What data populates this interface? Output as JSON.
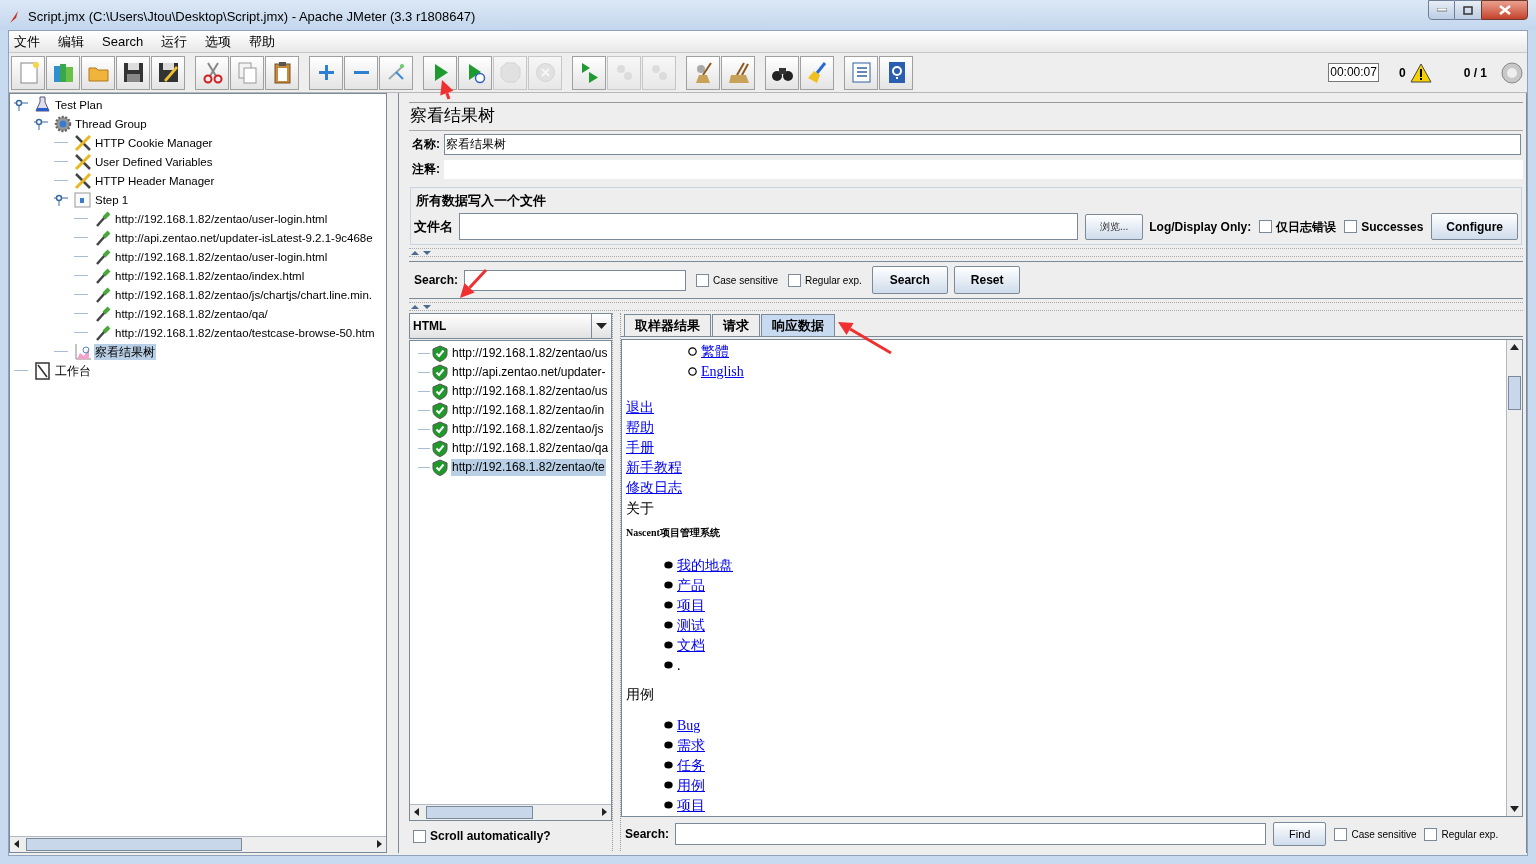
{
  "window": {
    "title": "Script.jmx (C:\\Users\\Jtou\\Desktop\\Script.jmx) - Apache JMeter (3.3 r1808647)"
  },
  "menu": [
    "文件",
    "编辑",
    "Search",
    "运行",
    "选项",
    "帮助"
  ],
  "toolbar": [
    [
      {
        "kind": "new",
        "disabled": false
      },
      {
        "kind": "templates",
        "disabled": false
      },
      {
        "kind": "open",
        "disabled": false
      },
      {
        "kind": "save",
        "disabled": false
      },
      {
        "kind": "save_as",
        "disabled": false
      }
    ],
    [
      {
        "kind": "cut",
        "disabled": false
      },
      {
        "kind": "copy",
        "disabled": false
      },
      {
        "kind": "paste",
        "disabled": false
      }
    ],
    [
      {
        "kind": "expand",
        "disabled": false
      },
      {
        "kind": "collapse",
        "disabled": false
      },
      {
        "kind": "toggle",
        "disabled": false
      }
    ],
    [
      {
        "kind": "start",
        "disabled": false
      },
      {
        "kind": "start_no_pause",
        "disabled": false
      },
      {
        "kind": "stop",
        "disabled": true
      },
      {
        "kind": "shutdown",
        "disabled": true
      }
    ],
    [
      {
        "kind": "remote_start",
        "disabled": false
      },
      {
        "kind": "remote_stop",
        "disabled": true
      },
      {
        "kind": "remote_shutdown",
        "disabled": true
      }
    ],
    [
      {
        "kind": "clear",
        "disabled": false
      },
      {
        "kind": "clear_all",
        "disabled": false
      }
    ],
    [
      {
        "kind": "search",
        "disabled": false
      },
      {
        "kind": "reset_search",
        "disabled": false
      }
    ],
    [
      {
        "kind": "function_helper",
        "disabled": false
      },
      {
        "kind": "help",
        "disabled": false
      }
    ]
  ],
  "status": {
    "timer": "00:00:07",
    "warnings": "0",
    "threads": "0 / 1"
  },
  "tree": [
    {
      "label": "Test Plan",
      "kind": "plan",
      "selected": false,
      "expanded": true,
      "children": [
        {
          "label": "Thread Group",
          "kind": "thread_group",
          "selected": false,
          "expanded": true,
          "children": [
            {
              "label": "HTTP Cookie Manager",
              "kind": "config",
              "selected": false
            },
            {
              "label": "User Defined Variables",
              "kind": "config",
              "selected": false
            },
            {
              "label": "HTTP Header Manager",
              "kind": "config",
              "selected": false
            },
            {
              "label": "Step 1",
              "kind": "controller",
              "selected": false,
              "expanded": true,
              "children": [
                {
                  "label": "http://192.168.1.82/zentao/user-login.html",
                  "kind": "sampler",
                  "selected": false
                },
                {
                  "label": "http://api.zentao.net/updater-isLatest-9.2.1-9c468e",
                  "kind": "sampler",
                  "selected": false
                },
                {
                  "label": "http://192.168.1.82/zentao/user-login.html",
                  "kind": "sampler",
                  "selected": false
                },
                {
                  "label": "http://192.168.1.82/zentao/index.html",
                  "kind": "sampler",
                  "selected": false
                },
                {
                  "label": "http://192.168.1.82/zentao/js/chartjs/chart.line.min.",
                  "kind": "sampler",
                  "selected": false
                },
                {
                  "label": "http://192.168.1.82/zentao/qa/",
                  "kind": "sampler",
                  "selected": false
                },
                {
                  "label": "http://192.168.1.82/zentao/testcase-browse-50.htm",
                  "kind": "sampler",
                  "selected": false
                }
              ]
            },
            {
              "label": "察看结果树",
              "kind": "listener",
              "selected": true
            }
          ]
        }
      ]
    },
    {
      "label": "工作台",
      "kind": "workbench",
      "selected": false
    }
  ],
  "panel": {
    "title": "察看结果树",
    "name_label": "名称:",
    "name_value": "察看结果树",
    "comment_label": "注释:",
    "file_group": {
      "legend": "所有数据写入一个文件",
      "file_label": "文件名",
      "browse": "浏览...",
      "log_label": "Log/Display Only:",
      "checks": [
        {
          "label": "仅日志错误",
          "checked": false
        },
        {
          "label": "Successes",
          "checked": false
        }
      ],
      "configure": "Configure"
    },
    "search": {
      "label": "Search:",
      "checks": [
        {
          "label": "Case sensitive",
          "checked": false
        },
        {
          "label": "Regular exp.",
          "checked": false
        }
      ],
      "search_button": "Search",
      "reset_button": "Reset"
    },
    "renderer": "HTML",
    "results": [
      {
        "label": "http://192.168.1.82/zentao/us",
        "success": true,
        "selected": false
      },
      {
        "label": "http://api.zentao.net/updater-",
        "success": true,
        "selected": false
      },
      {
        "label": "http://192.168.1.82/zentao/us",
        "success": true,
        "selected": false
      },
      {
        "label": "http://192.168.1.82/zentao/in",
        "success": true,
        "selected": false
      },
      {
        "label": "http://192.168.1.82/zentao/js",
        "success": true,
        "selected": false
      },
      {
        "label": "http://192.168.1.82/zentao/qa",
        "success": true,
        "selected": false
      },
      {
        "label": "http://192.168.1.82/zentao/te",
        "success": true,
        "selected": true
      }
    ],
    "scroll_auto": {
      "label": "Scroll automatically?",
      "checked": false
    },
    "tabs": [
      {
        "label": "取样器结果",
        "selected": false
      },
      {
        "label": "请求",
        "selected": false
      },
      {
        "label": "响应数据",
        "selected": true
      }
    ],
    "response": [
      {
        "kind": "circle_link",
        "text": "繁體"
      },
      {
        "kind": "circle_link",
        "text": "English"
      },
      {
        "kind": "link",
        "text": "退出"
      },
      {
        "kind": "link",
        "text": "帮助"
      },
      {
        "kind": "link",
        "text": "手册"
      },
      {
        "kind": "link",
        "text": "新手教程"
      },
      {
        "kind": "link",
        "text": "修改日志"
      },
      {
        "kind": "text",
        "text": "关于"
      },
      {
        "kind": "heading",
        "text": "Nascent项目管理系统"
      },
      {
        "kind": "bullet_link",
        "text": "我的地盘"
      },
      {
        "kind": "bullet_link",
        "text": "产品"
      },
      {
        "kind": "bullet_link",
        "text": "项目"
      },
      {
        "kind": "bullet_link",
        "text": "测试"
      },
      {
        "kind": "bullet_link",
        "text": "文档"
      },
      {
        "kind": "bullet_text",
        "text": "."
      },
      {
        "kind": "text",
        "text": "用例"
      },
      {
        "kind": "bullet_link",
        "text": "Bug"
      },
      {
        "kind": "bullet_link",
        "text": "需求"
      },
      {
        "kind": "bullet_link",
        "text": "任务"
      },
      {
        "kind": "bullet_link",
        "text": "用例"
      },
      {
        "kind": "bullet_link",
        "text": "项目"
      }
    ],
    "find": {
      "label": "Search:",
      "button": "Find",
      "checks": [
        {
          "label": "Case sensitive",
          "checked": false
        },
        {
          "label": "Regular exp.",
          "checked": false
        }
      ]
    }
  }
}
